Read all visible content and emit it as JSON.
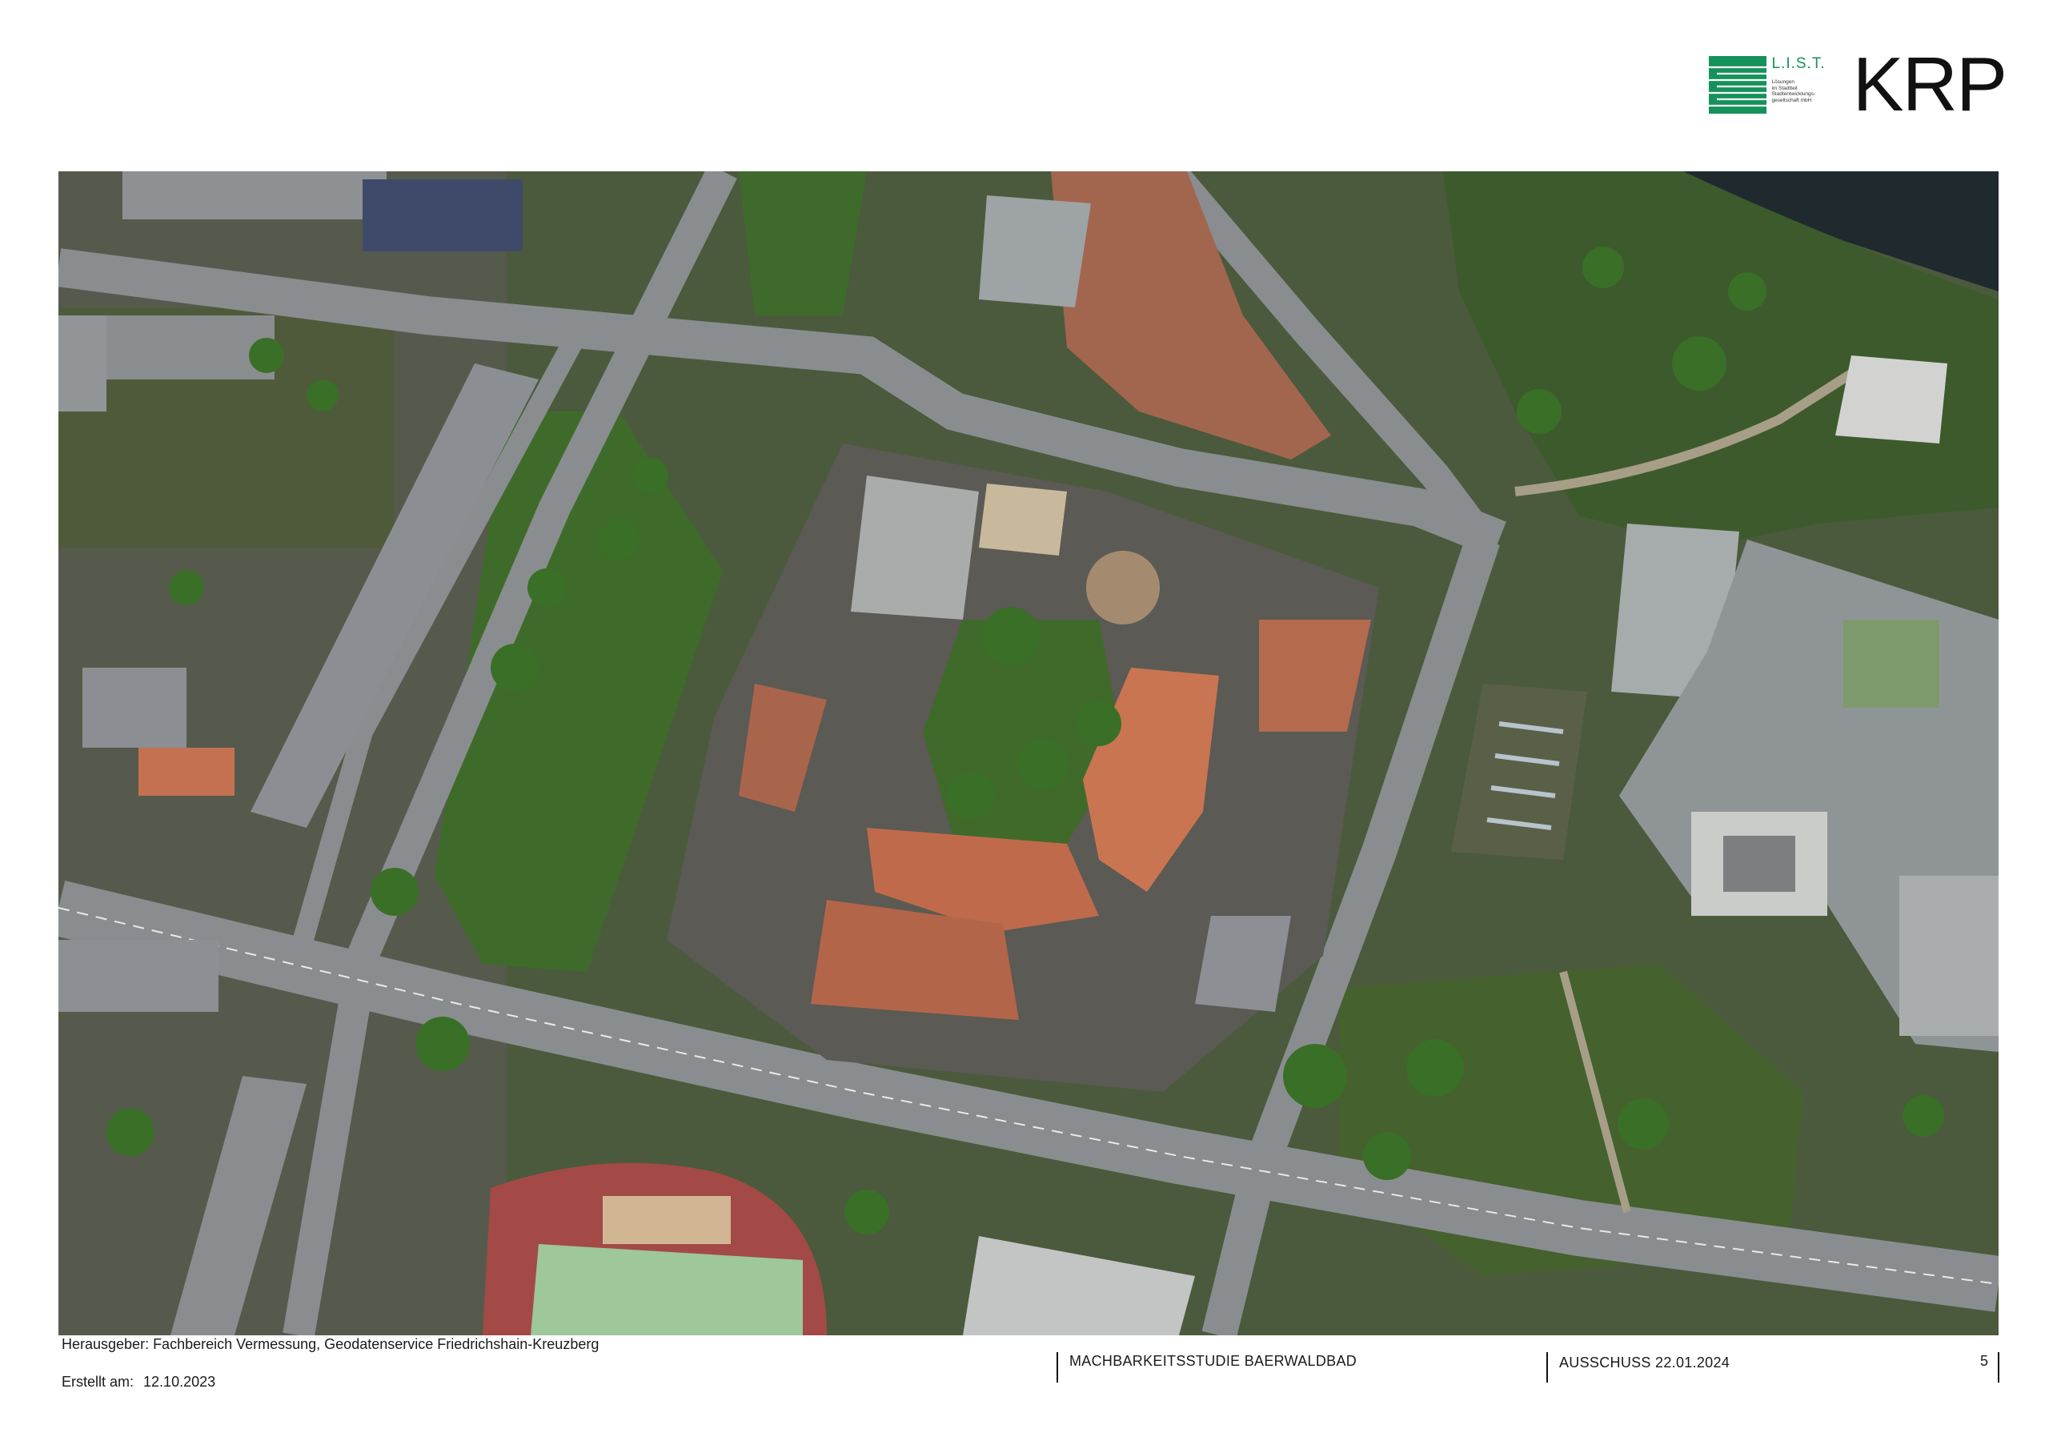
{
  "logos": {
    "list_title": "L.I.S.T.",
    "list_subtitle_lines": [
      "Lösungen",
      "im Stadtteil",
      "Stadtentwicklungs-",
      "gesellschaft mbH"
    ],
    "list_color": "#15925a",
    "krp_text": "KRP"
  },
  "map": {
    "kind": "aerial orthophoto"
  },
  "footer": {
    "publisher": "Herausgeber: Fachbereich Vermessung, Geodatenservice Friedrichshain-Kreuzberg",
    "created_label": "Erstellt am:",
    "created_date": "12.10.2023",
    "study_title": "MACHBARKEITSSTUDIE BAERWALDBAD",
    "meeting": "AUSSCHUSS 22.01.2024",
    "page_number": "5"
  }
}
